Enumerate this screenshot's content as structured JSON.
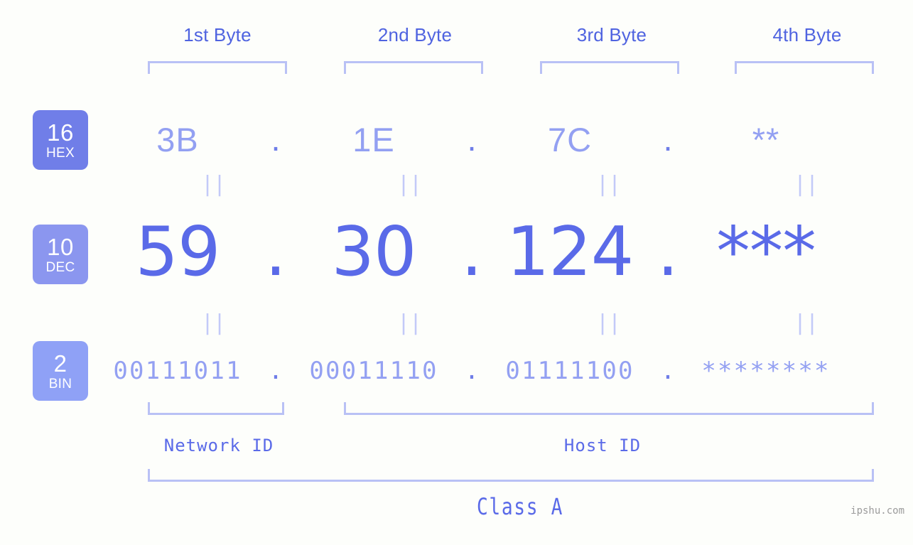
{
  "page": {
    "background": "#fdfefb",
    "accent_dark": "#5a6ae8",
    "accent_mid": "#707ee8",
    "accent_light": "#93a0f2",
    "accent_pale": "#b9c1f5",
    "watermark": "ipshu.com"
  },
  "headers": [
    {
      "label": "1st Byte"
    },
    {
      "label": "2nd Byte"
    },
    {
      "label": "3rd Byte"
    },
    {
      "label": "4th Byte"
    }
  ],
  "bases": [
    {
      "number": "16",
      "name": "HEX",
      "color": "#707ee8"
    },
    {
      "number": "10",
      "name": "DEC",
      "color": "#8b96ef"
    },
    {
      "number": "2",
      "name": "BIN",
      "color": "#8fa1f6"
    }
  ],
  "rows": {
    "hex": {
      "base_number": "16",
      "base_name": "HEX",
      "values": [
        "3B",
        "1E",
        "7C",
        "**"
      ],
      "separator": "."
    },
    "dec": {
      "base_number": "10",
      "base_name": "DEC",
      "values": [
        "59",
        "30",
        "124",
        "***"
      ],
      "separator": "."
    },
    "bin": {
      "base_number": "2",
      "base_name": "BIN",
      "values": [
        "00111011",
        "00011110",
        "01111100",
        "********"
      ],
      "separator": "."
    }
  },
  "equality_marks": {
    "glyph": "||",
    "count_per_row": 4,
    "rows": 2
  },
  "segments": {
    "network_id": "Network ID",
    "host_id": "Host ID",
    "class": "Class A"
  }
}
